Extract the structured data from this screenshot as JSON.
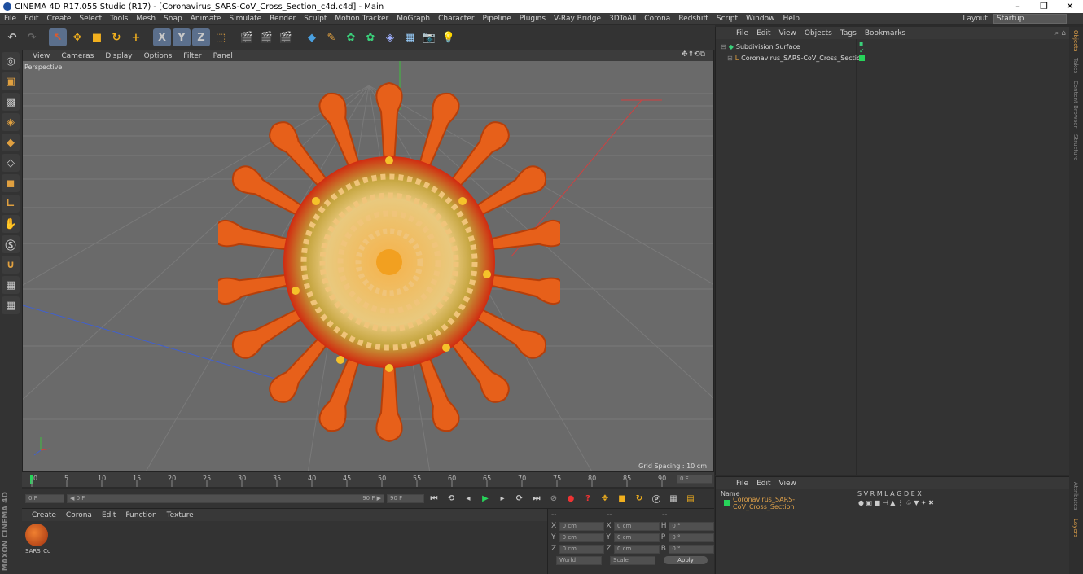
{
  "window": {
    "title": "CINEMA 4D R17.055 Studio (R17) - [Coronavirus_SARS-CoV_Cross_Section_c4d.c4d] - Main",
    "controls": [
      "–",
      "❐",
      "✕"
    ]
  },
  "menu": [
    "File",
    "Edit",
    "Create",
    "Select",
    "Tools",
    "Mesh",
    "Snap",
    "Animate",
    "Simulate",
    "Render",
    "Sculpt",
    "Motion Tracker",
    "MoGraph",
    "Character",
    "Pipeline",
    "Plugins",
    "V-Ray Bridge",
    "3DToAll",
    "Corona",
    "Redshift",
    "Script",
    "Window",
    "Help"
  ],
  "layout": {
    "label": "Layout:",
    "value": "Startup"
  },
  "toolbar": [
    "↶",
    "↷",
    "↖",
    "✥",
    "■",
    "↻",
    "+",
    "X",
    "Y",
    "Z",
    "⬚",
    "🎬",
    "🎬",
    "🎬",
    "◆",
    "✎",
    "✿",
    "✿",
    "◈",
    "▦",
    "📷",
    "💡"
  ],
  "viewport": {
    "menu": [
      "View",
      "Cameras",
      "Display",
      "Options",
      "Filter",
      "Panel"
    ],
    "nav_icons": "✥⇕⟲⧉",
    "camera": "Perspective",
    "grid_spacing": "Grid Spacing : 10 cm"
  },
  "timeline": {
    "ticks": [
      "0",
      "5",
      "10",
      "15",
      "20",
      "25",
      "30",
      "35",
      "40",
      "45",
      "50",
      "55",
      "60",
      "65",
      "70",
      "75",
      "80",
      "85",
      "90"
    ],
    "current_frame": "0 F"
  },
  "playbar": {
    "start_field": "0 F",
    "range_start": "◀ 0 F",
    "range_end": "90 F ▶",
    "end_field": "90 F"
  },
  "material_manager": {
    "menu": [
      "Create",
      "Corona",
      "Edit",
      "Function",
      "Texture"
    ],
    "material_name": "SARS_Co"
  },
  "coordinates": {
    "header": [
      "--",
      "--",
      "--"
    ],
    "rows": [
      {
        "a": "X",
        "av": "0 cm",
        "b": "X",
        "bv": "0 cm",
        "c": "H",
        "cv": "0 °"
      },
      {
        "a": "Y",
        "av": "0 cm",
        "b": "Y",
        "bv": "0 cm",
        "c": "P",
        "cv": "0 °"
      },
      {
        "a": "Z",
        "av": "0 cm",
        "b": "Z",
        "bv": "0 cm",
        "c": "B",
        "cv": "0 °"
      }
    ],
    "mode1": "World",
    "mode2": "Scale",
    "apply": "Apply"
  },
  "object_manager": {
    "menu": [
      "File",
      "Edit",
      "View",
      "Objects",
      "Tags",
      "Bookmarks"
    ],
    "objects": [
      "Subdivision Surface",
      "Coronavirus_SARS-CoV_Cross_Section"
    ]
  },
  "layer_manager": {
    "menu": [
      "File",
      "Edit",
      "View"
    ],
    "col_name": "Name",
    "columns": "S  V  R  M  L  A  G  D  E  X",
    "layer_name": "Coronavirus_SARS-CoV_Cross_Section"
  },
  "side_tabs": [
    "Objects",
    "Takes",
    "Content Browser",
    "Structure"
  ],
  "side_tabs_bottom": [
    "Attributes",
    "Layers"
  ],
  "brand": "MAXON CINEMA 4D"
}
